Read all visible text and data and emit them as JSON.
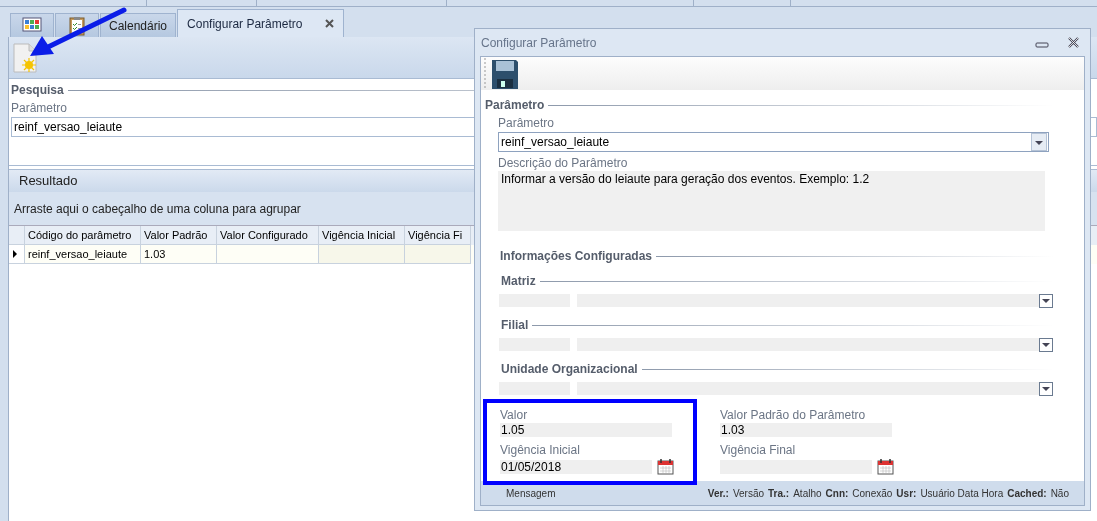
{
  "tabs": [
    {
      "kind": "icon",
      "selected": false
    },
    {
      "kind": "icon",
      "selected": false
    },
    {
      "kind": "text",
      "label": "Calendário",
      "selected": false
    },
    {
      "kind": "text",
      "label": "Configurar Parâmetro",
      "selected": true,
      "closable": true
    }
  ],
  "search": {
    "title": "Pesquisa",
    "label": "Parâmetro",
    "value": "reinf_versao_leiaute"
  },
  "result": {
    "title": "Resultado",
    "group_hint": "Arraste aqui o cabeçalho de uma coluna para agrupar",
    "columns": [
      "Código do parâmetro",
      "Valor Padrão",
      "Valor Configurado",
      "Vigência Inicial",
      "Vigência Fi"
    ],
    "rows": [
      {
        "cells": [
          "reinf_versao_leiaute",
          "1.03"
        ],
        "current": true
      }
    ]
  },
  "dialog": {
    "title": "Configurar Parâmetro",
    "section": "Parâmetro",
    "param": {
      "label": "Parâmetro",
      "value": "reinf_versao_leiaute"
    },
    "description": {
      "label": "Descrição do Parâmetro",
      "value": "Informar a versão do leiaute para geração dos eventos. Exemplo: 1.2"
    },
    "config_title": "Informações Configuradas",
    "groups": [
      "Matriz",
      "Filial",
      "Unidade Organizacional"
    ],
    "valor": {
      "label": "Valor",
      "value": "1.05"
    },
    "valor_padrao": {
      "label": "Valor Padrão do Parâmetro",
      "value": "1.03"
    },
    "vigencia_inicial": {
      "label": "Vigência Inicial",
      "value": "01/05/2018"
    },
    "vigencia_final": {
      "label": "Vigência Final"
    },
    "status_message": "Mensagem",
    "status_items": [
      {
        "key": "Ver.:",
        "value": "Versão"
      },
      {
        "key": "Tra.:",
        "value": "Atalho"
      },
      {
        "key": "Cnn:",
        "value": "Conexão"
      },
      {
        "key": "Usr:",
        "value": "Usuário Data Hora"
      },
      {
        "key": "Cached:",
        "value": "Não"
      }
    ]
  },
  "annotations": {
    "arrow": true,
    "highlight_frame": true
  }
}
